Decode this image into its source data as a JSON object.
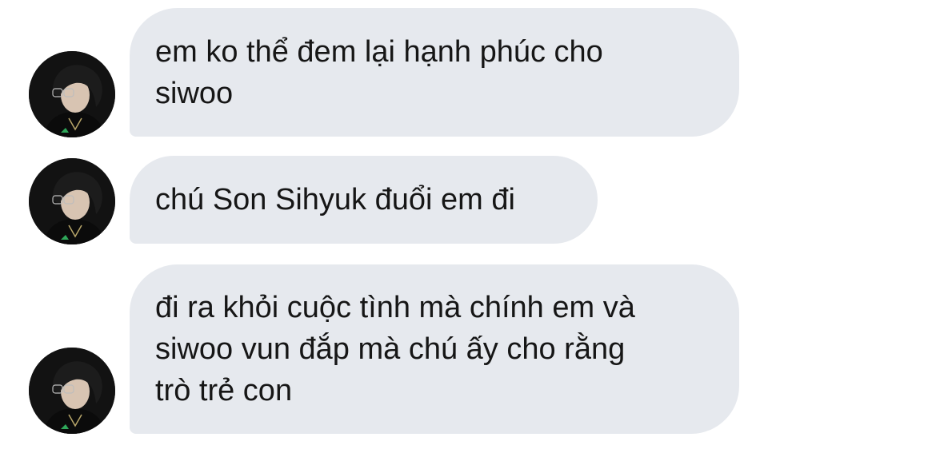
{
  "conversation": {
    "messages": [
      {
        "sender_avatar": "avatar-icon",
        "text": "em ko thể đem lại hạnh phúc cho\nsiwoo"
      },
      {
        "sender_avatar": "avatar-icon",
        "text": "chú Son Sihyuk đuổi em đi"
      },
      {
        "sender_avatar": "avatar-icon",
        "text": "đi ra khỏi cuộc tình mà chính em và\nsiwoo vun đắp mà chú ấy cho rằng\ntrò trẻ con"
      }
    ]
  },
  "colors": {
    "bubble_background": "#e6e9ee",
    "text": "#161616",
    "page_background": "#ffffff"
  }
}
